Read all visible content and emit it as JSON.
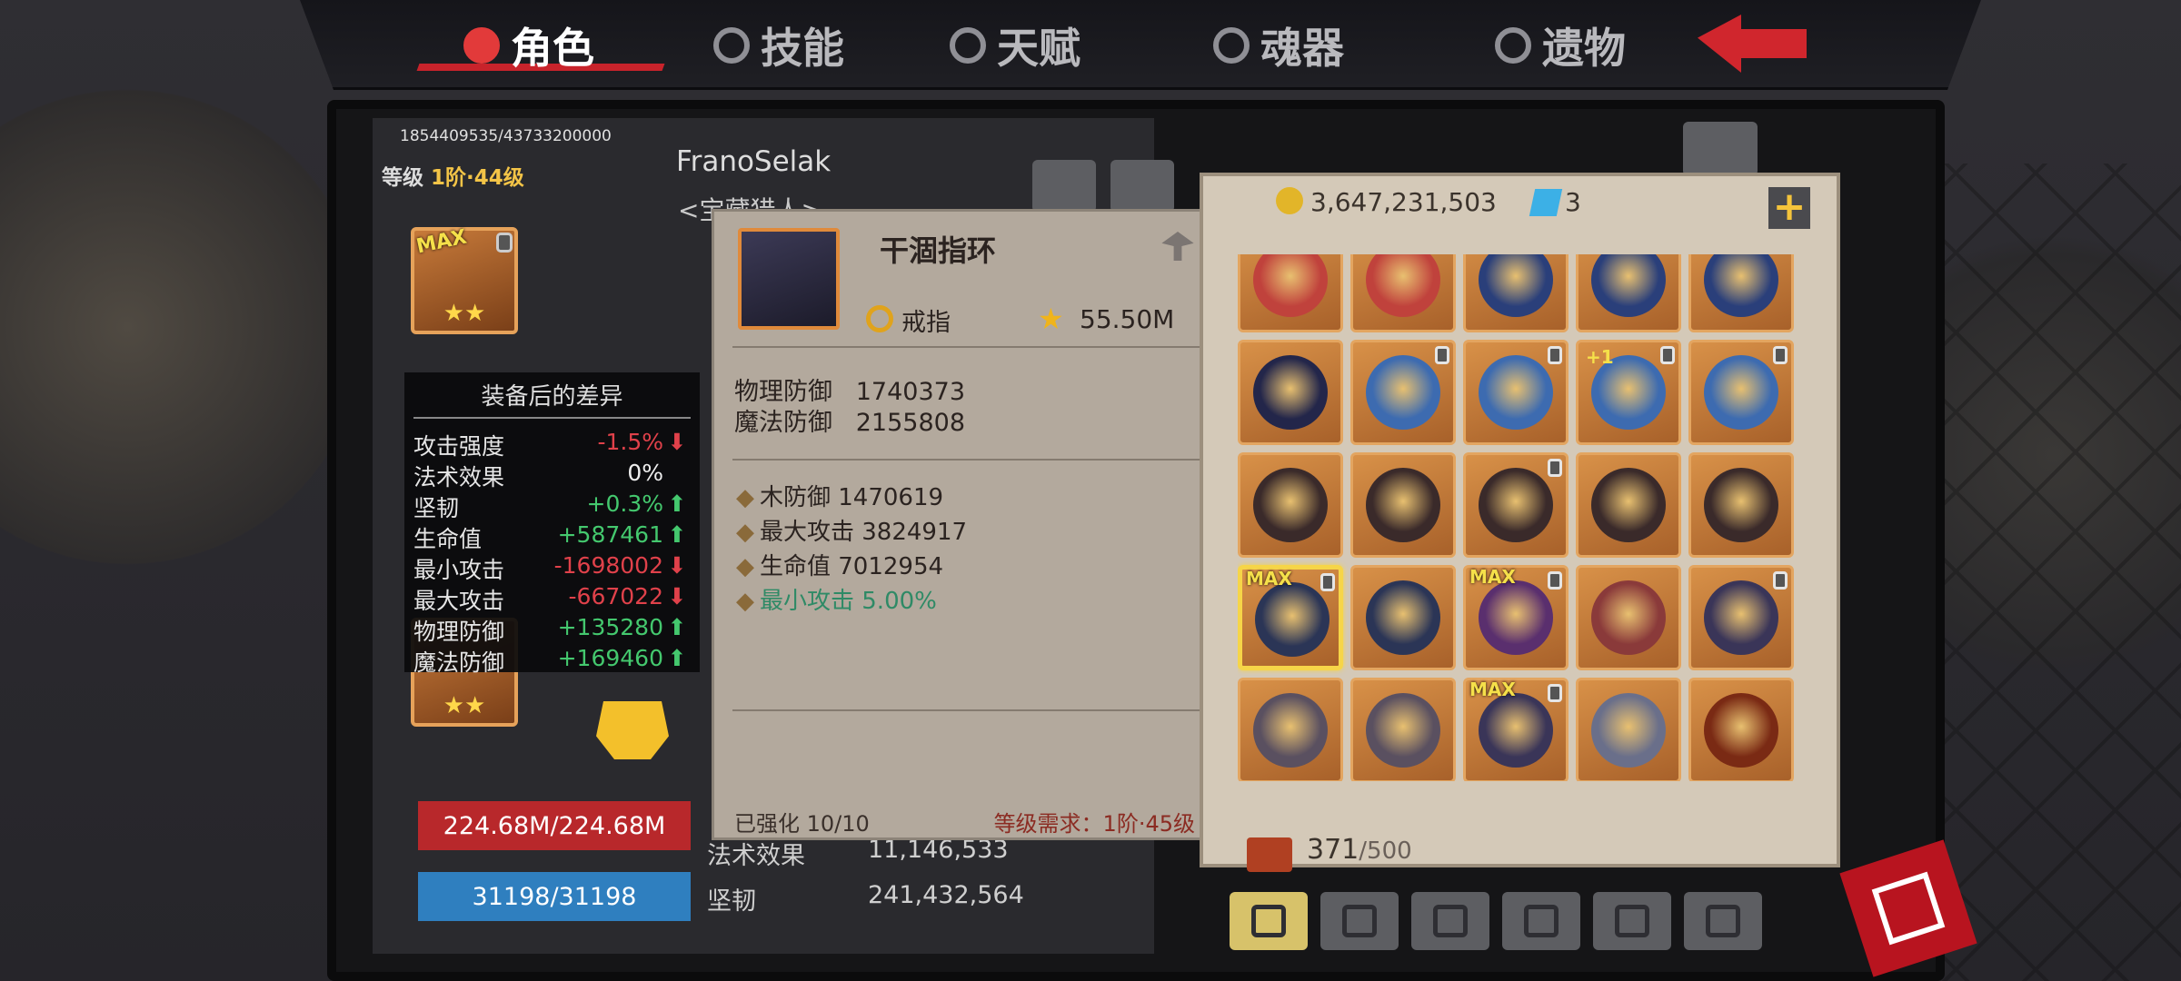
{
  "tabs": [
    {
      "label": "角色",
      "active": true
    },
    {
      "label": "技能",
      "active": false
    },
    {
      "label": "天赋",
      "active": false
    },
    {
      "label": "魂器",
      "active": false
    },
    {
      "label": "遗物",
      "active": false
    }
  ],
  "character": {
    "exp": "1854409535/43733200000",
    "level_label": "等级",
    "level_value": "1阶·44级",
    "name": "FranoSelak",
    "title_partial": "<宝藏猎人>",
    "hp": "224.68M/224.68M",
    "mp": "31198/31198",
    "stats_bottom": [
      {
        "label": "法术效果",
        "value": "11,146,533"
      },
      {
        "label": "坚韧",
        "value": "241,432,564"
      }
    ]
  },
  "diff_panel": {
    "title": "装备后的差异",
    "rows": [
      {
        "label": "攻击强度",
        "value": "-1.5%",
        "trend": "down"
      },
      {
        "label": "法术效果",
        "value": "0%",
        "trend": "none"
      },
      {
        "label": "坚韧",
        "value": "+0.3%",
        "trend": "up"
      },
      {
        "label": "生命值",
        "value": "+587461",
        "trend": "up"
      },
      {
        "label": "最小攻击",
        "value": "-1698002",
        "trend": "down"
      },
      {
        "label": "最大攻击",
        "value": "-667022",
        "trend": "down"
      },
      {
        "label": "物理防御",
        "value": "+135280",
        "trend": "up"
      },
      {
        "label": "魔法防御",
        "value": "+169460",
        "trend": "up"
      }
    ]
  },
  "tooltip": {
    "name": "干涸指环",
    "type": "戒指",
    "power": "55.50M",
    "base_stats": [
      {
        "label": "物理防御",
        "value": "1740373"
      },
      {
        "label": "魔法防御",
        "value": "2155808"
      }
    ],
    "affixes": [
      {
        "text": "木防御 1470619",
        "green": false
      },
      {
        "text": "最大攻击 3824917",
        "green": false
      },
      {
        "text": "生命值 7012954",
        "green": false
      },
      {
        "text": "最小攻击 5.00%",
        "green": true
      }
    ],
    "enhance": "已强化 10/10",
    "requirement": "等级需求：1阶·45级"
  },
  "inventory": {
    "gold": "3,647,231,503",
    "gems": "3",
    "count": "371",
    "capacity": "/500",
    "badges": {
      "max": "MAX",
      "plus": "+1"
    },
    "items": [
      {
        "art": "#c0423c",
        "max": false,
        "lock": false,
        "plus": false,
        "selected": false
      },
      {
        "art": "#c0423c",
        "max": false,
        "lock": false,
        "plus": false,
        "selected": false
      },
      {
        "art": "#2a3f7a",
        "max": false,
        "lock": false,
        "plus": false,
        "selected": false
      },
      {
        "art": "#2a3f7a",
        "max": false,
        "lock": false,
        "plus": false,
        "selected": false
      },
      {
        "art": "#2a3f7a",
        "max": false,
        "lock": false,
        "plus": false,
        "selected": false
      },
      {
        "art": "#23264a",
        "max": false,
        "lock": false,
        "plus": false,
        "selected": false
      },
      {
        "art": "#3d6bb0",
        "max": false,
        "lock": true,
        "plus": false,
        "selected": false
      },
      {
        "art": "#3d6bb0",
        "max": false,
        "lock": true,
        "plus": false,
        "selected": false
      },
      {
        "art": "#3d6bb0",
        "max": false,
        "lock": true,
        "plus": true,
        "selected": false
      },
      {
        "art": "#3d6bb0",
        "max": false,
        "lock": true,
        "plus": false,
        "selected": false
      },
      {
        "art": "#3a2a2a",
        "max": false,
        "lock": false,
        "plus": false,
        "selected": false
      },
      {
        "art": "#3a2a2a",
        "max": false,
        "lock": false,
        "plus": false,
        "selected": false
      },
      {
        "art": "#3a2a2a",
        "max": false,
        "lock": true,
        "plus": false,
        "selected": false
      },
      {
        "art": "#3a2a2a",
        "max": false,
        "lock": false,
        "plus": false,
        "selected": false
      },
      {
        "art": "#3a2a2a",
        "max": false,
        "lock": false,
        "plus": false,
        "selected": false
      },
      {
        "art": "#2b3556",
        "max": true,
        "lock": true,
        "plus": false,
        "selected": true
      },
      {
        "art": "#2b3556",
        "max": false,
        "lock": false,
        "plus": false,
        "selected": false
      },
      {
        "art": "#5a2f6e",
        "max": true,
        "lock": true,
        "plus": false,
        "selected": false
      },
      {
        "art": "#8a3a3a",
        "max": false,
        "lock": false,
        "plus": false,
        "selected": false
      },
      {
        "art": "#3a3558",
        "max": false,
        "lock": true,
        "plus": false,
        "selected": false
      },
      {
        "art": "#5a5060",
        "max": false,
        "lock": false,
        "plus": false,
        "selected": false
      },
      {
        "art": "#5a5060",
        "max": false,
        "lock": false,
        "plus": false,
        "selected": false
      },
      {
        "art": "#3a3558",
        "max": true,
        "lock": true,
        "plus": false,
        "selected": false
      },
      {
        "art": "#6a6f8a",
        "max": false,
        "lock": false,
        "plus": false,
        "selected": false
      },
      {
        "art": "#7a2a14",
        "max": false,
        "lock": false,
        "plus": false,
        "selected": false
      }
    ],
    "category_tabs": [
      {
        "icon": "toolbox-icon",
        "active": true
      },
      {
        "icon": "armor-icon",
        "active": false
      },
      {
        "icon": "potion-icon",
        "active": false
      },
      {
        "icon": "leaf-icon",
        "active": false
      },
      {
        "icon": "gem-icon",
        "active": false
      },
      {
        "icon": "scroll-icon",
        "active": false
      }
    ]
  },
  "colors": {
    "accent_red": "#c8232b",
    "positive": "#44c86e",
    "negative": "#e0414a"
  }
}
